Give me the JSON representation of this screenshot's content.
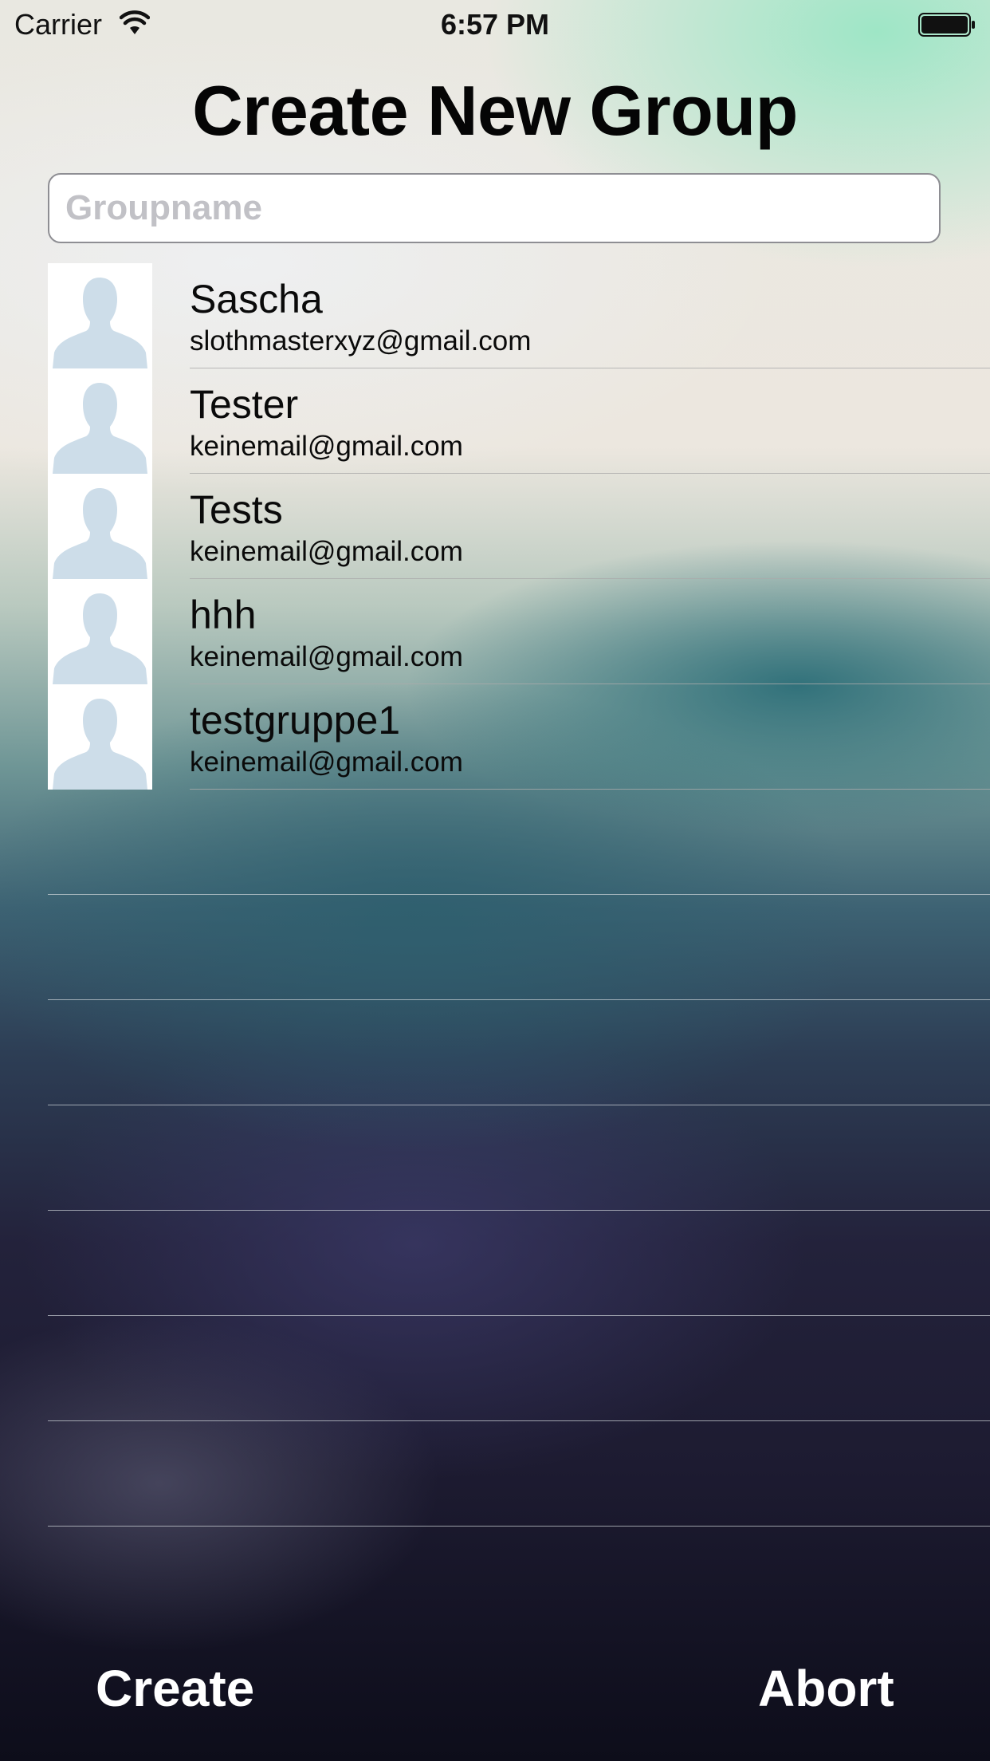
{
  "status_bar": {
    "carrier": "Carrier",
    "time": "6:57 PM"
  },
  "title": "Create New Group",
  "groupname_input": {
    "placeholder": "Groupname",
    "value": ""
  },
  "contacts": [
    {
      "name": "Sascha",
      "email": "slothmasterxyz@gmail.com"
    },
    {
      "name": "Tester",
      "email": "keinemail@gmail.com"
    },
    {
      "name": "Tests",
      "email": "keinemail@gmail.com"
    },
    {
      "name": "hhh",
      "email": "keinemail@gmail.com"
    },
    {
      "name": "testgruppe1",
      "email": "keinemail@gmail.com"
    }
  ],
  "footer": {
    "create_label": "Create",
    "abort_label": "Abort"
  },
  "icons": {
    "avatar": "person-silhouette-icon",
    "wifi": "wifi-icon",
    "battery": "battery-icon"
  },
  "colors": {
    "avatar_silhouette": "#cddde9",
    "title_text": "#050505",
    "button_text": "#ffffff"
  }
}
